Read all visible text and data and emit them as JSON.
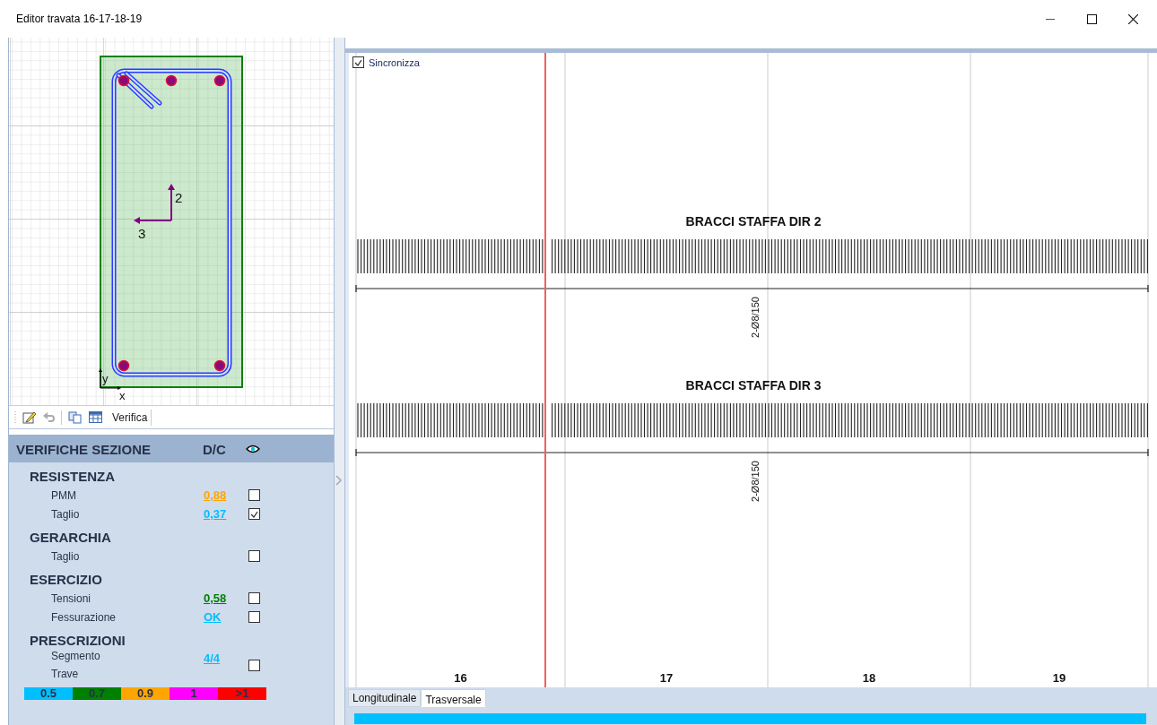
{
  "window": {
    "title": "Editor travata 16-17-18-19"
  },
  "section": {
    "axis_labels": [
      "2",
      "3"
    ],
    "origin_labels": [
      "y",
      "x"
    ]
  },
  "toolbar": {
    "button_label": "Verifica"
  },
  "checks": {
    "title": "VERIFICHE SEZIONE",
    "dc_header": "D/C",
    "groups": [
      {
        "title": "RESISTENZA",
        "rows": [
          {
            "label": "PMM",
            "value": "0,88",
            "color": "#ffa500",
            "checked": false
          },
          {
            "label": "Taglio",
            "value": "0,37",
            "color": "#00bfff",
            "checked": true
          }
        ]
      },
      {
        "title": "GERARCHIA",
        "rows": [
          {
            "label": "Taglio",
            "checked": false
          }
        ]
      },
      {
        "title": "ESERCIZIO",
        "rows": [
          {
            "label": "Tensioni",
            "value": "0,58",
            "color": "#008000",
            "checked": false
          },
          {
            "label": "Fessurazione",
            "value": "OK",
            "color": "#00bfff",
            "checked": false
          }
        ]
      },
      {
        "title": "PRESCRIZIONI",
        "rows": [
          {
            "label": "Segmento",
            "sublabel": "Trave",
            "value": "4/4",
            "color": "#00bfff",
            "checked": false
          }
        ]
      }
    ]
  },
  "legend": [
    {
      "label": "0.5",
      "color": "#00bfff"
    },
    {
      "label": "0.7",
      "color": "#008000"
    },
    {
      "label": "0.9",
      "color": "#ffa500"
    },
    {
      "label": "1",
      "color": "#ff00ff"
    },
    {
      "label": ">1",
      "color": "#ff0000"
    }
  ],
  "sync": {
    "label": "Sincronizza",
    "checked": true
  },
  "diagrams": [
    {
      "title": "BRACCI STAFFA DIR 2",
      "annotation": "2-Ø8/150"
    },
    {
      "title": "BRACCI STAFFA DIR 3",
      "annotation": "2-Ø8/150"
    }
  ],
  "spans": [
    "16",
    "17",
    "18",
    "19"
  ],
  "tabs": [
    {
      "label": "Longitudinale",
      "selected": false
    },
    {
      "label": "Trasversale",
      "selected": true
    }
  ]
}
